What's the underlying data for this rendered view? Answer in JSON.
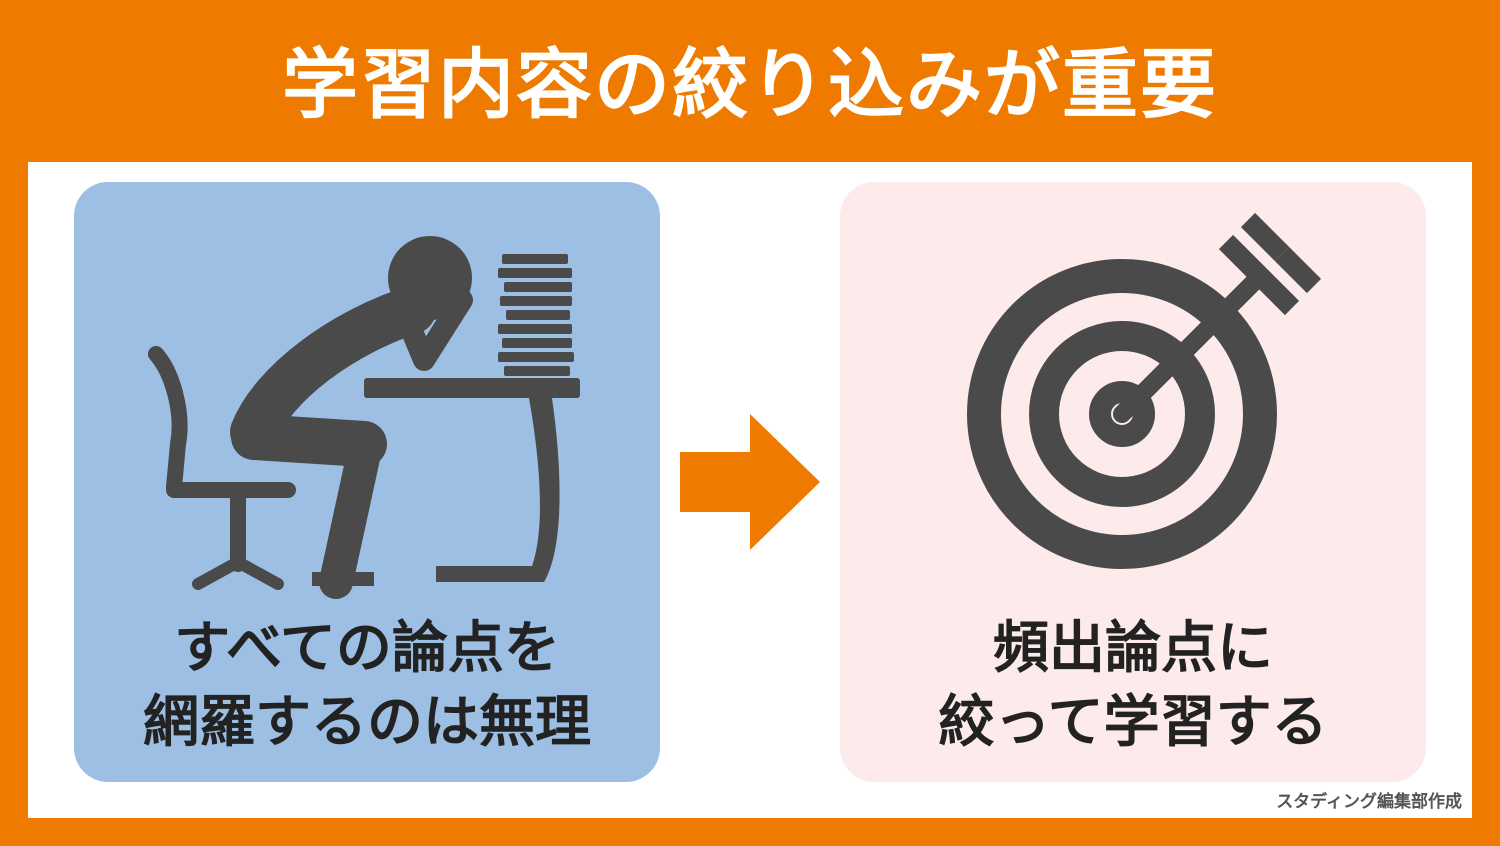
{
  "title": "学習内容の絞り込みが重要",
  "left_card": {
    "illustration": "stressed-student-desk-icon",
    "caption_line1": "すべての論点を",
    "caption_line2": "網羅するのは無理"
  },
  "arrow": "arrow-right-icon",
  "right_card": {
    "illustration": "target-arrow-icon",
    "caption_line1": "頻出論点に",
    "caption_line2": "絞って学習する"
  },
  "credit": "スタディング編集部作成",
  "colors": {
    "background": "#ee7a00",
    "left_card": "#9dbfe3",
    "right_card": "#fdeaea",
    "icon": "#4a4a4a"
  }
}
